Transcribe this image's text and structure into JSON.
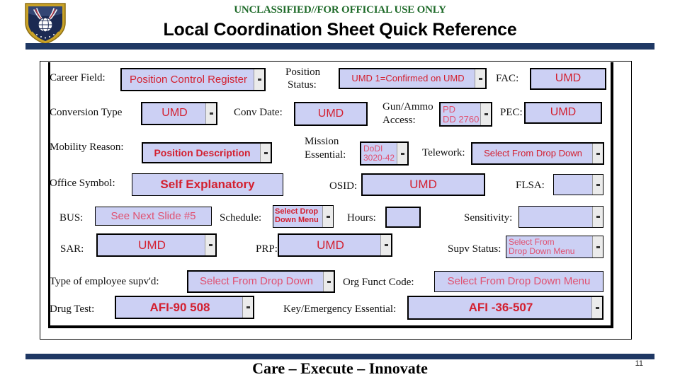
{
  "header": {
    "classification": "UNCLASSIFIED//FOR OFFICIAL USE ONLY",
    "title": "Local Coordination Sheet Quick Reference",
    "seal_name": "air-force-seal",
    "rule_color": "#1F3864"
  },
  "footer": {
    "motto": "Care – Execute – Innovate",
    "slide_number": "11",
    "rule_color": "#1F3864"
  },
  "colors": {
    "field_fill": "#CCD0F4",
    "field_text": "#D32030",
    "field_border": "#000000",
    "dropdown_button": "#EBEBEB",
    "classification_text": "#1F6B2A"
  },
  "form": {
    "fields": [
      {
        "label": "Career Field:",
        "value": "Position Control Register",
        "dropdown": true,
        "style": "normal"
      },
      {
        "label": "Position\nStatus:",
        "value": "UMD  1=Confirmed on UMD",
        "dropdown": true,
        "style": "small"
      },
      {
        "label": "FAC:",
        "value": "UMD",
        "dropdown": false,
        "style": "normal"
      },
      {
        "label": "Conversion Type",
        "value": "UMD",
        "dropdown": true,
        "style": "normal"
      },
      {
        "label": "Conv Date:",
        "value": "UMD",
        "dropdown": false,
        "style": "normal"
      },
      {
        "label": "Gun/Ammo\nAccess:",
        "value": "PD\nDD 2760",
        "dropdown": true,
        "style": "small"
      },
      {
        "label": "PEC:",
        "value": "UMD",
        "dropdown": false,
        "style": "normal"
      },
      {
        "label": "Mobility Reason:",
        "value": "Position Description",
        "dropdown": true,
        "style": "normal"
      },
      {
        "label": "Mission\nEssential:",
        "value": "DoDI\n3020-42",
        "dropdown": true,
        "style": "small"
      },
      {
        "label": "Telework:",
        "value": "Select From Drop Down",
        "dropdown": true,
        "style": "normal"
      },
      {
        "label": "Office Symbol:",
        "value": "Self Explanatory",
        "dropdown": false,
        "style": "normal"
      },
      {
        "label": "OSID:",
        "value": "UMD",
        "dropdown": false,
        "style": "normal"
      },
      {
        "label": "FLSA:",
        "value": "",
        "dropdown": true,
        "style": "normal"
      },
      {
        "label": "BUS:",
        "value": "See Next Slide #5",
        "dropdown": false,
        "style": "pink"
      },
      {
        "label": "Schedule:",
        "value": "Select Drop\nDown Menu",
        "dropdown": true,
        "style": "bold-small"
      },
      {
        "label": "Hours:",
        "value": "",
        "dropdown": false,
        "style": "normal"
      },
      {
        "label": "Sensitivity:",
        "value": "",
        "dropdown": true,
        "style": "normal"
      },
      {
        "label": "SAR:",
        "value": "UMD",
        "dropdown": true,
        "style": "normal"
      },
      {
        "label": "PRP:",
        "value": "UMD",
        "dropdown": true,
        "style": "normal"
      },
      {
        "label": "Supv Status:",
        "value": "Select From\nDrop Down Menu",
        "dropdown": true,
        "style": "small"
      },
      {
        "label": "Type of employee supv'd:",
        "value": "Select From Drop Down",
        "dropdown": true,
        "style": "pink"
      },
      {
        "label": "Org Funct Code:",
        "value": "Select From Drop Down Menu",
        "dropdown": false,
        "style": "pink"
      },
      {
        "label": "Drug Test:",
        "value": "AFI-90 508",
        "dropdown": true,
        "style": "normal"
      },
      {
        "label": "Key/Emergency Essential:",
        "value": "AFI -36-507",
        "dropdown": true,
        "style": "normal"
      }
    ],
    "labels": {
      "career_field": "Career Field:",
      "position_status_l1": "Position",
      "position_status_l2": "Status:",
      "fac": "FAC:",
      "conversion_type": "Conversion Type",
      "conv_date": "Conv Date:",
      "gun_ammo_l1": "Gun/Ammo",
      "gun_ammo_l2": "Access:",
      "pec": "PEC:",
      "mobility_reason": "Mobility Reason:",
      "mission_essential_l1": "Mission",
      "mission_essential_l2": "Essential:",
      "telework": "Telework:",
      "office_symbol": "Office Symbol:",
      "osid": "OSID:",
      "flsa": "FLSA:",
      "bus": "BUS:",
      "schedule": "Schedule:",
      "hours": "Hours:",
      "sensitivity": "Sensitivity:",
      "sar": "SAR:",
      "prp": "PRP:",
      "supv_status": "Supv Status:",
      "type_employee_supvd": "Type of employee supv'd:",
      "org_funct_code": "Org Funct Code:",
      "drug_test": "Drug Test:",
      "key_emergency_essential": "Key/Emergency Essential:"
    },
    "values": {
      "career_field": "Position Control Register",
      "position_status": "UMD  1=Confirmed on UMD",
      "fac": "UMD",
      "conversion_type": "UMD",
      "conv_date": "UMD",
      "gun_ammo_l1": "PD",
      "gun_ammo_l2": "DD 2760",
      "pec": "UMD",
      "mobility_reason": "Position Description",
      "mission_essential_l1": "DoDI",
      "mission_essential_l2": "3020-42",
      "telework": "Select From Drop Down",
      "office_symbol": "Self Explanatory",
      "osid": "UMD",
      "flsa": "",
      "bus": "See Next Slide #5",
      "schedule_l1": "Select Drop",
      "schedule_l2": "Down Menu",
      "hours": "",
      "sensitivity": "",
      "sar": "UMD",
      "prp": "UMD",
      "supv_status_l1": "Select From",
      "supv_status_l2": "Drop Down Menu",
      "type_employee_supvd": "Select From Drop Down",
      "org_funct_code": "Select From Drop Down Menu",
      "drug_test": "AFI-90 508",
      "key_emergency_essential": "AFI -36-507"
    }
  }
}
